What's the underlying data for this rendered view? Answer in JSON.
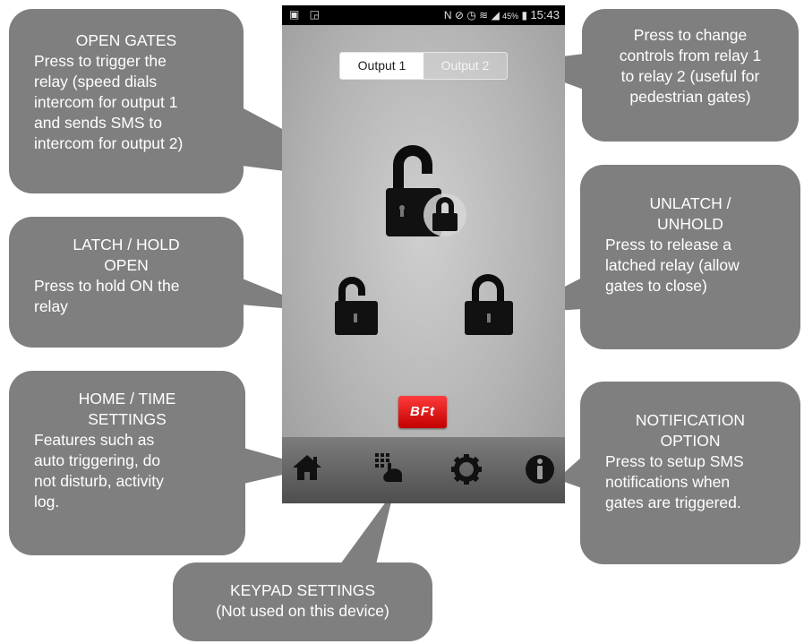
{
  "status_bar": {
    "time": "15:43",
    "battery": "45%"
  },
  "tabs": [
    {
      "label": "Output 1"
    },
    {
      "label": "Output 2"
    }
  ],
  "brand": {
    "logo_text": "BFt",
    "color": "#e01010"
  },
  "nav": {
    "icons": [
      "home-icon",
      "keypad-icon",
      "gear-icon",
      "info-icon"
    ]
  },
  "callouts": {
    "open_gates": {
      "title": "OPEN GATES",
      "body": [
        "Press to trigger the",
        "relay (speed dials",
        "intercom for output 1",
        "and sends SMS to",
        "intercom for output 2)"
      ]
    },
    "change_controls": {
      "body": [
        "Press to change",
        "controls from relay 1",
        "to relay 2 (useful for",
        "pedestrian gates)"
      ]
    },
    "latch": {
      "title": [
        "LATCH / HOLD",
        "OPEN"
      ],
      "body": [
        "Press to hold ON the",
        "relay"
      ]
    },
    "unlatch": {
      "title": [
        "UNLATCH /",
        "UNHOLD"
      ],
      "body": [
        "Press to release a",
        "latched relay (allow",
        "gates to close)"
      ]
    },
    "home": {
      "title": [
        "HOME / TIME",
        "SETTINGS"
      ],
      "body": [
        "Features such as",
        "auto triggering, do",
        "not disturb, activity",
        "log."
      ]
    },
    "notification": {
      "title": [
        "NOTIFICATION",
        "OPTION"
      ],
      "body": [
        "Press to setup SMS",
        "notifications when",
        "gates are triggered."
      ]
    },
    "keypad": {
      "body": [
        "KEYPAD SETTINGS",
        "(Not used on this device)"
      ]
    }
  },
  "colors": {
    "callout_bg": "#7f7f7f",
    "status_bar": "#000000"
  }
}
